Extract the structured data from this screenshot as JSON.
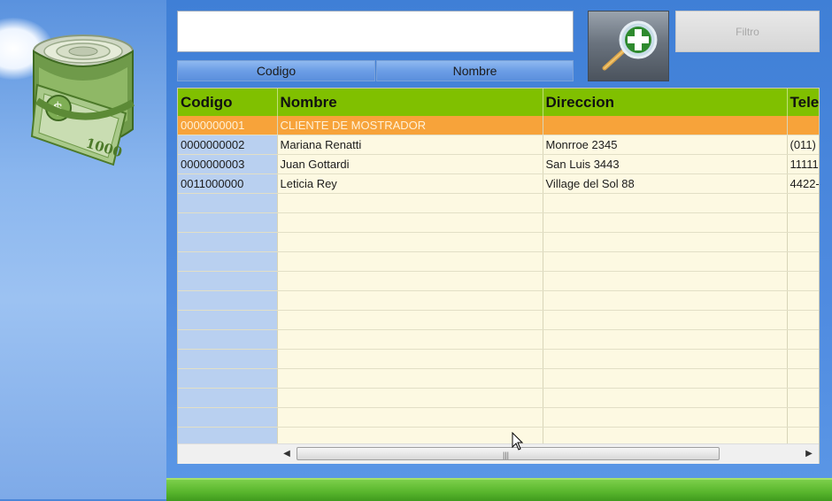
{
  "filter": {
    "search_value": "",
    "code_button": "Codigo",
    "name_button": "Nombre",
    "filtro_button": "Filtro"
  },
  "grid": {
    "columns": [
      "Codigo",
      "Nombre",
      "Direccion",
      "Tele"
    ],
    "rows": [
      {
        "codigo": "0000000001",
        "nombre": "CLIENTE DE MOSTRADOR",
        "direccion": "",
        "telefono": ""
      },
      {
        "codigo": "0000000002",
        "nombre": "Mariana Renatti",
        "direccion": "Monrroe 2345",
        "telefono": "(011)"
      },
      {
        "codigo": "0000000003",
        "nombre": "Juan Gottardi",
        "direccion": "San Luis 3443",
        "telefono": "11111"
      },
      {
        "codigo": "0011000000",
        "nombre": "Leticia Rey",
        "direccion": "Village del Sol 88",
        "telefono": "4422-"
      }
    ],
    "selected_row": 0
  },
  "logo_text": "1000",
  "colors": {
    "header_green": "#80c000",
    "selected_orange": "#f7a33a",
    "grid_bg": "#fdf9e2",
    "code_cell_blue": "#b9d0f0"
  },
  "icons": [
    "money-roll-icon",
    "search-add-icon",
    "scroll-left-icon",
    "scroll-right-icon",
    "mouse-cursor-icon"
  ]
}
